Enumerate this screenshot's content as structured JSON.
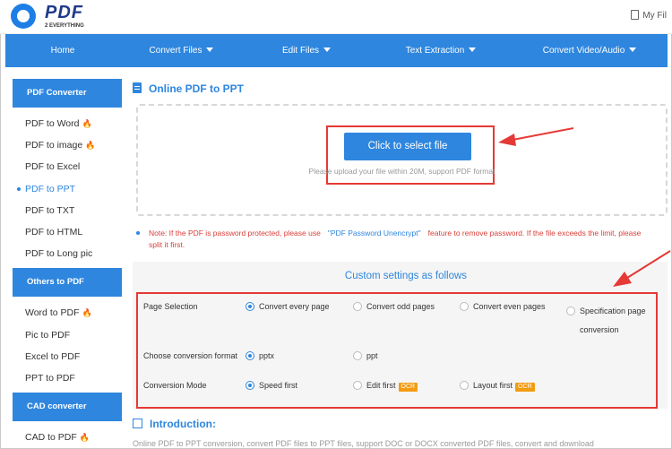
{
  "header": {
    "logo_text": "PDF",
    "logo_tagline": "2 EVERYTHING",
    "my_files": "My Fil"
  },
  "nav": {
    "items": [
      {
        "label": "Home",
        "caret": false
      },
      {
        "label": "Convert Files",
        "caret": true
      },
      {
        "label": "Edit Files",
        "caret": true
      },
      {
        "label": "Text Extraction",
        "caret": true
      },
      {
        "label": "Convert Video/Audio",
        "caret": true
      }
    ]
  },
  "sidebar": {
    "sections": [
      {
        "title": "PDF Converter",
        "items": [
          {
            "label": "PDF to Word",
            "hot": true,
            "active": false
          },
          {
            "label": "PDF to image",
            "hot": true,
            "active": false
          },
          {
            "label": "PDF to Excel",
            "hot": false,
            "active": false
          },
          {
            "label": "PDF to PPT",
            "hot": false,
            "active": true
          },
          {
            "label": "PDF to TXT",
            "hot": false,
            "active": false
          },
          {
            "label": "PDF to HTML",
            "hot": false,
            "active": false
          },
          {
            "label": "PDF to Long pic",
            "hot": false,
            "active": false
          }
        ]
      },
      {
        "title": "Others to PDF",
        "items": [
          {
            "label": "Word to PDF",
            "hot": true,
            "active": false
          },
          {
            "label": "Pic to PDF",
            "hot": false,
            "active": false
          },
          {
            "label": "Excel to PDF",
            "hot": false,
            "active": false
          },
          {
            "label": "PPT to PDF",
            "hot": false,
            "active": false
          }
        ]
      },
      {
        "title": "CAD converter",
        "items": [
          {
            "label": "CAD to PDF",
            "hot": true,
            "active": false
          }
        ]
      }
    ]
  },
  "main": {
    "title": "Online PDF to PPT",
    "select_button": "Click to select file",
    "upload_hint": "Please upload your file within 20M, support PDF format",
    "note_prefix": "Note: If the PDF is password protected, please use",
    "note_link": "\"PDF Password Unencrypt\"",
    "note_suffix": "feature to remove password. If the file exceeds the limit, please",
    "note_line2": "split it first.",
    "settings_title": "Custom settings as follows",
    "settings": {
      "page_selection": {
        "label": "Page Selection",
        "options": [
          "Convert every page",
          "Convert odd pages",
          "Convert even pages",
          "Specification page"
        ],
        "option4_line2": "conversion",
        "selected": 0
      },
      "format": {
        "label": "Choose conversion format",
        "options": [
          "pptx",
          "ppt"
        ],
        "selected": 0
      },
      "mode": {
        "label": "Conversion Mode",
        "options": [
          "Speed first",
          "Edit first",
          "Layout first"
        ],
        "ocr_badge": "OCR",
        "selected": 0
      }
    },
    "intro_title": "Introduction:",
    "intro_text": "Online PDF to PPT conversion, convert PDF files to PPT files, support DOC or DOCX converted PDF files, convert and download"
  },
  "colors": {
    "brand_blue": "#2e86de",
    "annotation_red": "#e53935",
    "hot_orange": "#f07b3f",
    "ocr_orange": "#f39c12"
  }
}
